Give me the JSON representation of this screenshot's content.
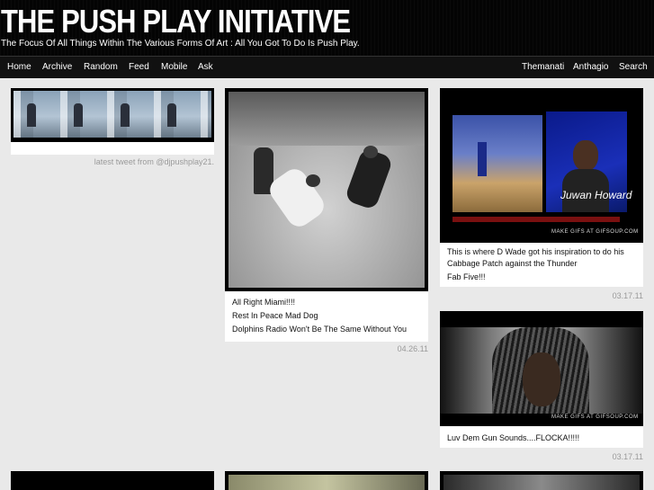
{
  "site": {
    "title": "THE PUSH PLAY INITIATIVE",
    "tagline": "The Focus Of All Things Within The Various Forms Of Art : All You Got To Do Is Push Play."
  },
  "nav": {
    "left": [
      "Home",
      "Archive",
      "Random",
      "Feed",
      "Mobile",
      "Ask"
    ],
    "right": [
      "Themanati",
      "Anthagio",
      "Search"
    ]
  },
  "posts": {
    "twitter": {
      "caption": "latest tweet from @djpushplay21."
    },
    "miami": {
      "lines": [
        "All Right Miami!!!!",
        "Rest In Peace Mad Dog",
        "Dolphins Radio Won't Be The Same Without You"
      ],
      "date": "04.26.11"
    },
    "juwan": {
      "name_overlay": "Juwan Howard",
      "watermark": "MAKE GIFS AT GIFSOUP.COM",
      "lines": [
        "This is where D Wade got his inspiration to do his",
        "Cabbage Patch against the Thunder",
        "Fab Five!!!"
      ],
      "date": "03.17.11"
    },
    "flocka": {
      "watermark": "MAKE GIFS AT GIFSOUP.COM",
      "lines": [
        "Luv Dem Gun Sounds....FLOCKA!!!!!"
      ],
      "date": "03.17.11"
    }
  }
}
